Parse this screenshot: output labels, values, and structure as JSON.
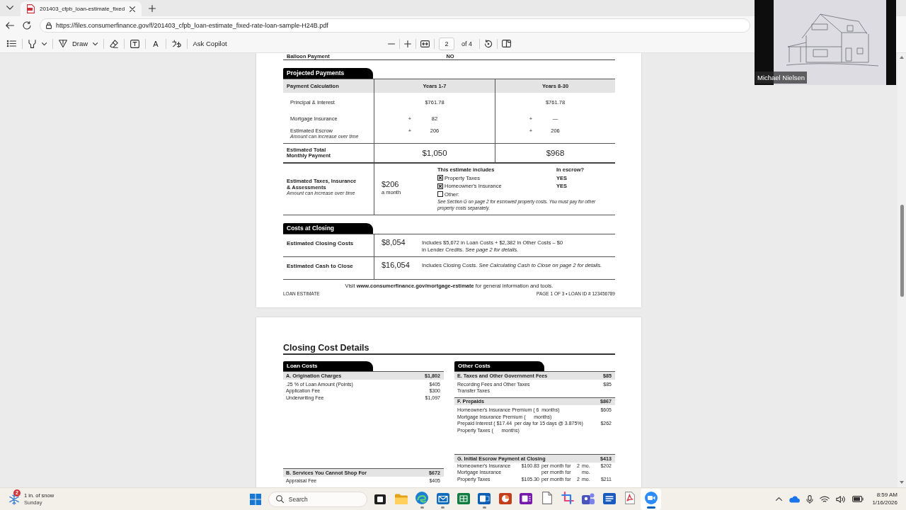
{
  "browser": {
    "tab_title": "201403_cfpb_loan-estimate_fixed",
    "url": "https://files.consumerfinance.gov/f/201403_cfpb_loan-estimate_fixed-rate-loan-sample-H24B.pdf"
  },
  "pdf_toolbar": {
    "draw_label": "Draw",
    "read_aloud_glyph": "A",
    "copilot_label": "Ask Copilot",
    "page": "2",
    "page_total": "of 4"
  },
  "video_tile": {
    "name": "Michael Nielsen"
  },
  "page_1": {
    "balloon": {
      "label": "Balloon Payment",
      "value": "NO"
    },
    "projected_payments": {
      "heading": "Projected Payments",
      "label_header": "Payment Calculation",
      "columns": [
        "Years 1-7",
        "Years 8-30"
      ],
      "rows": [
        {
          "label": "Principal & Interest",
          "cells": [
            {
              "value": "$761.78"
            },
            {
              "value": "$761.78"
            }
          ]
        },
        {
          "label": "Mortgage Insurance",
          "cells": [
            {
              "sign": "+",
              "value": "82"
            },
            {
              "sign": "+",
              "value": "—"
            }
          ]
        },
        {
          "label": "Estimated Escrow",
          "note": "Amount can increase over time",
          "cells": [
            {
              "sign": "+",
              "value": "206"
            },
            {
              "sign": "+",
              "value": "206"
            }
          ]
        }
      ],
      "total": {
        "label": "Estimated Total\nMonthly Payment",
        "values": [
          "$1,050",
          "$968"
        ]
      }
    },
    "taxes": {
      "label": "Estimated Taxes, Insurance\n& Assessments",
      "note": "Amount can increase over time",
      "amount": "$206",
      "period": "a month",
      "includes_heading": "This estimate includes",
      "escrow_heading": "In escrow?",
      "items": [
        {
          "label": "Property Taxes",
          "checked": true,
          "escrow": "YES"
        },
        {
          "label": "Homeowner's Insurance",
          "checked": true,
          "escrow": "YES"
        },
        {
          "label": "Other:",
          "checked": false
        }
      ],
      "footnote": "See Section G on page 2 for escrowed property costs. You must pay for other property costs separately."
    },
    "costs_at_closing": {
      "heading": "Costs at Closing",
      "rows": [
        {
          "label": "Estimated Closing Costs",
          "amount": "$8,054",
          "text": "Includes $5,672 in Loan Costs + $2,382 in Other Costs – $0\nin Lender Credits. *See page 2 for details.*"
        },
        {
          "label": "Estimated Cash to Close",
          "amount": "$16,054",
          "text": "Includes Closing Costs. *See Calculating Cash to Close on page 2 for details.*"
        }
      ]
    },
    "footer": {
      "visit": "Visit **www.consumerfinance.gov/mortgage-estimate** for general information and tools.",
      "form_name": "LOAN ESTIMATE",
      "page_info": "PAGE 1 OF 3 • LOAN ID # 123456789"
    }
  },
  "page_2": {
    "title": "Closing Cost Details",
    "loan_costs": {
      "heading": "Loan Costs",
      "sections": [
        {
          "kind": "fees",
          "label": "A. Origination Charges",
          "amount": "$1,802",
          "items": [
            {
              "label": ".25 % of Loan Amount (Points)",
              "amount": "$405"
            },
            {
              "label": "Application Fee",
              "amount": "$300"
            },
            {
              "label": "Underwriting Fee",
              "amount": "$1,097"
            }
          ]
        },
        {
          "kind": "fees",
          "label": "B. Services You Cannot Shop For",
          "amount": "$672",
          "items": [
            {
              "label": "Appraisal Fee",
              "amount": "$405"
            }
          ]
        }
      ]
    },
    "other_costs": {
      "heading": "Other Costs",
      "sections": [
        {
          "kind": "fees",
          "label": "E. Taxes and Other Government Fees",
          "amount": "$85",
          "items": [
            {
              "label": "Recording Fees and Other Taxes",
              "amount": "$85"
            },
            {
              "label": "Transfer Taxes"
            }
          ]
        },
        {
          "kind": "fees",
          "label": "F. Prepaids",
          "amount": "$867",
          "items": [
            {
              "label": "Homeowner's Insurance Premium ( 6  months)",
              "amount": "$605"
            },
            {
              "label": "Mortgage Insurance Premium (      months)"
            },
            {
              "label": "Prepaid Interest ( $17.44  per day for 15 days @ 3.875%)",
              "amount": "$262"
            },
            {
              "label": "Property Taxes (      months)"
            }
          ]
        },
        {
          "kind": "escrow",
          "label": "G. Initial Escrow Payment at Closing",
          "amount": "$413",
          "items": [
            {
              "label": "Homeowner's Insurance",
              "rate": "$100.83",
              "per": "per month for",
              "months": "2",
              "unit": "mo.",
              "amount": "$202"
            },
            {
              "label": "Mortgage Insurance",
              "per": "per month for",
              "unit": "mo."
            },
            {
              "label": "Property Taxes",
              "rate": "$105.30",
              "per": "per month for",
              "months": "2",
              "unit": "mo.",
              "amount": "$211"
            }
          ]
        }
      ]
    }
  },
  "taskbar": {
    "weather": {
      "badge": "2",
      "condition": "1 in. of snow",
      "day": "Sunday"
    },
    "search": {
      "label": "Search"
    },
    "apps": [
      {
        "kind": "taskview",
        "running": false,
        "selected": false
      },
      {
        "kind": "folder",
        "running": false,
        "selected": false
      },
      {
        "kind": "browser",
        "running": true,
        "selected": false
      },
      {
        "kind": "mail",
        "running": true,
        "selected": false
      },
      {
        "kind": "sheet",
        "running": false,
        "selected": false
      },
      {
        "kind": "mailbox",
        "running": true,
        "selected": false
      },
      {
        "kind": "slides",
        "running": false,
        "selected": false
      },
      {
        "kind": "notebook",
        "running": false,
        "selected": false
      },
      {
        "kind": "textfile",
        "running": false,
        "selected": false
      },
      {
        "kind": "snip",
        "running": false,
        "selected": false
      },
      {
        "kind": "chat",
        "running": false,
        "selected": false
      },
      {
        "kind": "writer",
        "running": false,
        "selected": false
      },
      {
        "kind": "pdf",
        "running": false,
        "selected": false
      },
      {
        "kind": "meeting",
        "running": true,
        "selected": true
      }
    ],
    "clock": {
      "time": "8:59 AM",
      "date": "1/16/2026"
    }
  }
}
